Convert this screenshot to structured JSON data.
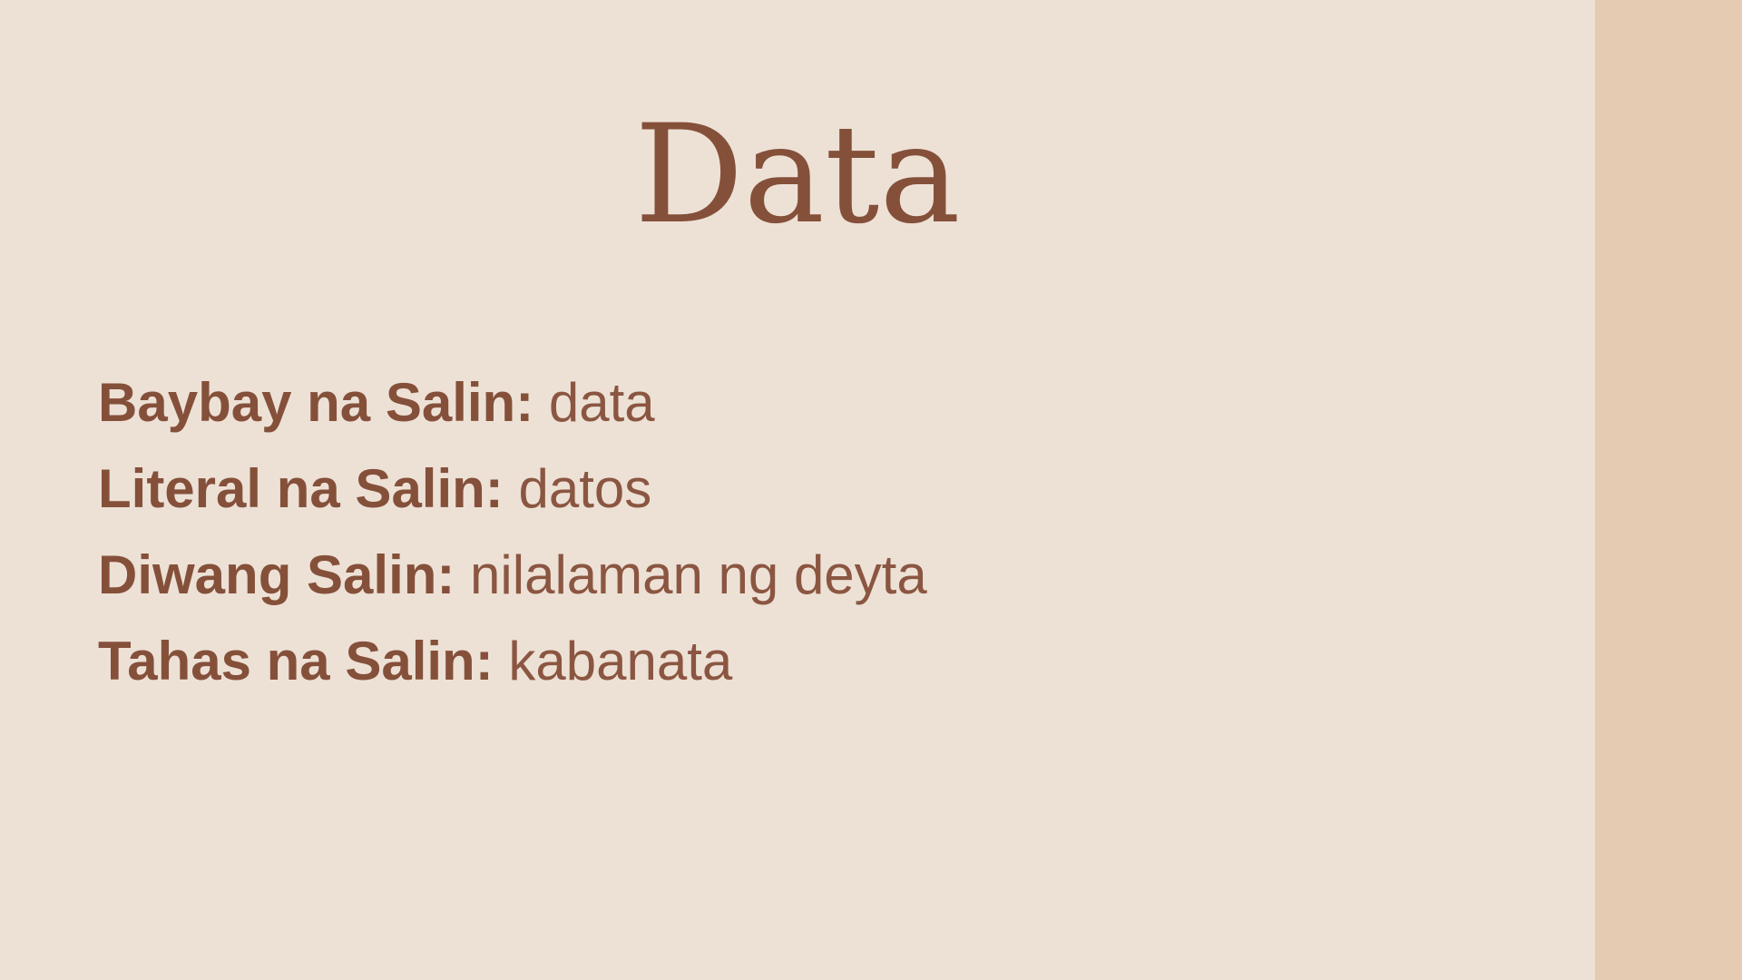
{
  "slide": {
    "title": "Data",
    "entries": [
      {
        "label": "Baybay na Salin:",
        "value": "data"
      },
      {
        "label": "Literal na Salin:",
        "value": "datos"
      },
      {
        "label": "Diwang Salin:",
        "value": "nilalaman ng deyta"
      },
      {
        "label": "Tahas na Salin:",
        "value": "kabanata"
      }
    ]
  },
  "colors": {
    "background": "#ede1d6",
    "side_band": "#e4cbb1",
    "text": "#85503a"
  }
}
